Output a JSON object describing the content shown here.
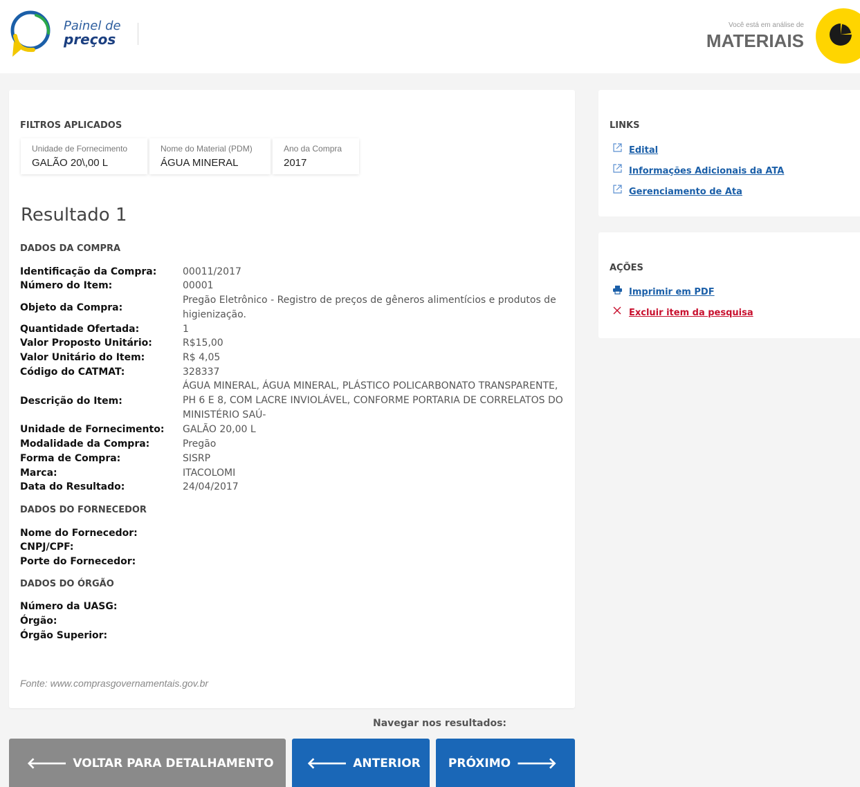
{
  "header": {
    "logo_line1": "Painel de",
    "logo_line2": "preços",
    "analise_label": "Você está em análise de",
    "analise_value": "MATERIAIS"
  },
  "filtros": {
    "title": "FILTROS APLICADOS",
    "chips": [
      {
        "label": "Unidade de Fornecimento",
        "value": "GALÃO 20\\,00 L"
      },
      {
        "label": "Nome do Material (PDM)",
        "value": "ÁGUA MINERAL"
      },
      {
        "label": "Ano da Compra",
        "value": "2017"
      }
    ]
  },
  "resultado_title": "Resultado 1",
  "compra": {
    "title": "DADOS DA COMPRA",
    "rows": [
      {
        "label": "Identificação da Compra:",
        "value": "00011/2017"
      },
      {
        "label": "Número do Item:",
        "value": "00001"
      },
      {
        "label": "Objeto da Compra:",
        "value": "Pregão Eletrônico - Registro de preços de gêneros alimentícios e produtos de higienização."
      },
      {
        "label": "Quantidade Ofertada:",
        "value": "1"
      },
      {
        "label": "Valor Proposto Unitário:",
        "value": "R$15,00"
      },
      {
        "label": "Valor Unitário do Item:",
        "value": "R$ 4,05"
      },
      {
        "label": "Código do CATMAT:",
        "value": "328337"
      },
      {
        "label": "Descrição do Item:",
        "value": "ÁGUA MINERAL, ÁGUA MINERAL, PLÁSTICO POLICARBONATO TRANSPARENTE, PH 6 E 8, COM LACRE INVIOLÁVEL, CONFORME PORTARIA DE CORRELATOS DO MINISTÉRIO SAÚ-"
      },
      {
        "label": "Unidade de Fornecimento:",
        "value": "GALÃO 20,00 L"
      },
      {
        "label": "Modalidade da Compra:",
        "value": "Pregão"
      },
      {
        "label": "Forma de Compra:",
        "value": "SISRP"
      },
      {
        "label": "Marca:",
        "value": "ITACOLOMI"
      },
      {
        "label": "Data do Resultado:",
        "value": "24/04/2017"
      }
    ]
  },
  "fornecedor": {
    "title": "DADOS DO FORNECEDOR",
    "rows": [
      {
        "label": "Nome do Fornecedor:"
      },
      {
        "label": "CNPJ/CPF:"
      },
      {
        "label": "Porte do Fornecedor:"
      }
    ]
  },
  "orgao": {
    "title": "DADOS DO ÓRGÃO",
    "rows": [
      {
        "label": "Número da UASG:"
      },
      {
        "label": "Órgão:"
      },
      {
        "label": "Órgão Superior:"
      }
    ]
  },
  "fonte": "Fonte: www.comprasgovernamentais.gov.br",
  "links": {
    "title": "LINKS",
    "items": [
      {
        "label": "Edital",
        "icon": "external-link-icon"
      },
      {
        "label": "Informações Adicionais da ATA",
        "icon": "external-link-icon"
      },
      {
        "label": "Gerenciamento de Ata",
        "icon": "external-link-icon"
      }
    ]
  },
  "acoes": {
    "title": "AÇÕES",
    "items": [
      {
        "label": "Imprimir em PDF",
        "icon": "printer-icon"
      },
      {
        "label": "Excluir item da pesquisa",
        "icon": "close-icon"
      }
    ]
  },
  "nav": {
    "label": "Navegar nos resultados:",
    "voltar": "VOLTAR PARA DETALHAMENTO",
    "anterior": "ANTERIOR",
    "proximo": "PRÓXIMO"
  },
  "colors": {
    "accent_blue": "#1a67b7",
    "brand_yellow": "#ffd500",
    "danger_red": "#c8102e"
  }
}
